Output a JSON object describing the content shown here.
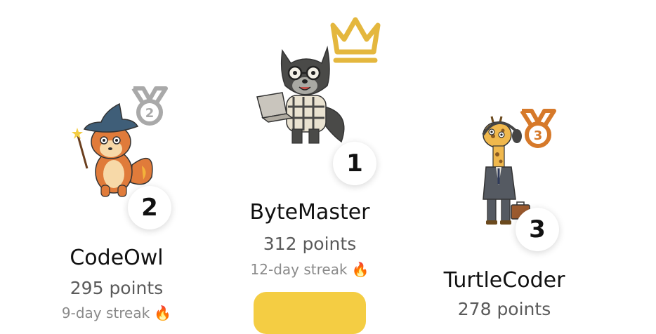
{
  "leaderboard": [
    {
      "rank": "1",
      "name": "ByteMaster",
      "points": "312 points",
      "streak": "12-day streak",
      "streak_emoji": "🔥",
      "award": "crown-icon",
      "award_color": "#e4b73e",
      "avatar": "wolf-coder-avatar"
    },
    {
      "rank": "2",
      "name": "CodeOwl",
      "points": "295 points",
      "streak": "9-day streak",
      "streak_emoji": "🔥",
      "award": "silver-medal-icon",
      "award_color": "#a9a9a9",
      "avatar": "fox-wizard-avatar"
    },
    {
      "rank": "3",
      "name": "TurtleCoder",
      "points": "278 points",
      "streak": "",
      "streak_emoji": "",
      "award": "bronze-medal-icon",
      "award_color": "#d6792a",
      "avatar": "giraffe-business-avatar"
    }
  ],
  "cta": {
    "label": "",
    "color": "#f4cd43"
  }
}
